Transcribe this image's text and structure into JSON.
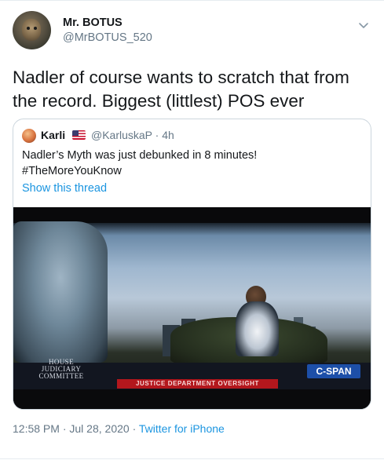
{
  "tweet": {
    "display_name": "Mr. BOTUS",
    "handle": "@MrBOTUS_520",
    "text": "Nadler of course wants to scratch that from the record. Biggest (littlest) POS ever",
    "time": "12:58 PM",
    "date_separator": " · ",
    "date": "Jul 28, 2020",
    "source_separator": " · ",
    "source": "Twitter for iPhone",
    "menu_icon": "chevron-down-icon"
  },
  "quoted": {
    "display_name": "Karli",
    "flag_icon": "us-flag-icon",
    "handle_time": "@KarluskaP · 4h",
    "text_line1": "Nadler’s Myth was just debunked in 8 minutes!",
    "text_line2": "#TheMoreYouKnow",
    "link": "Show this thread",
    "video": {
      "logo_line1": "HOUSE",
      "logo_line2": "JUDICIARY",
      "logo_line3": "COMMITTEE",
      "network": "C-SPAN",
      "chyron": "JUSTICE DEPARTMENT OVERSIGHT"
    }
  },
  "colors": {
    "text": "#14171a",
    "muted": "#657786",
    "link": "#1b95e0",
    "border": "#ccd6dd",
    "cspan_blue": "#1d4fa8",
    "chyron_red": "#b3171d"
  }
}
